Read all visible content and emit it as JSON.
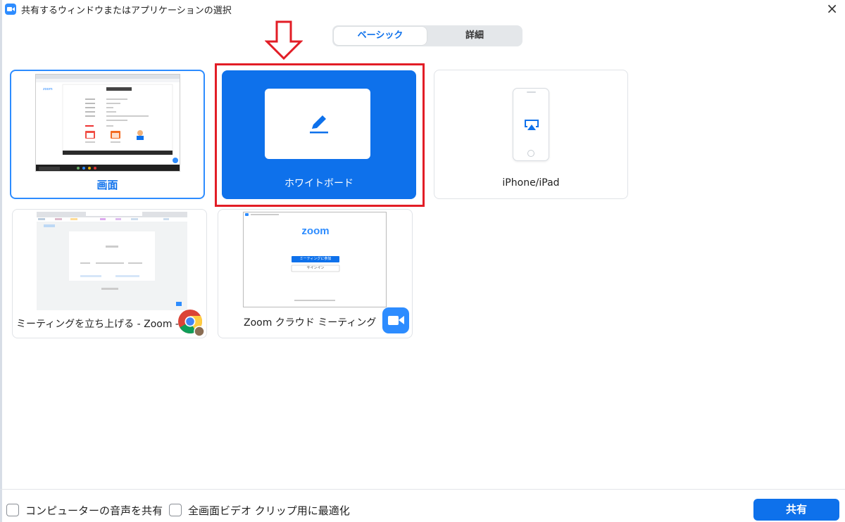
{
  "window": {
    "title": "共有するウィンドウまたはアプリケーションの選択",
    "close_glyph": "×"
  },
  "tabs": [
    {
      "label": "ベーシック",
      "selected": true
    },
    {
      "label": "詳細",
      "selected": false
    }
  ],
  "tiles": {
    "screen": {
      "label": "画面"
    },
    "whiteboard": {
      "label": "ホワイトボード",
      "selected": true
    },
    "iphone": {
      "label": "iPhone/iPad"
    },
    "chrome_window": {
      "label": "ミーティングを立ち上げる - Zoom - ..."
    },
    "zoom_window": {
      "label": "Zoom クラウド ミーティング",
      "thumb_logo": "zoom",
      "thumb_button_1": "ミーティングに参加",
      "thumb_button_2": "サインイン"
    }
  },
  "footer": {
    "share_audio_label": "コンピューターの音声を共有",
    "optimize_video_label": "全画面ビデオ クリップ用に最適化",
    "share_button": "共有"
  },
  "colors": {
    "accent": "#0e71eb",
    "annotation_red": "#e21d26"
  },
  "icons": [
    "zoom-app-icon",
    "close-icon",
    "down-arrow-icon",
    "pen-icon",
    "airplay-icon",
    "chrome-icon",
    "zoom-video-icon"
  ]
}
